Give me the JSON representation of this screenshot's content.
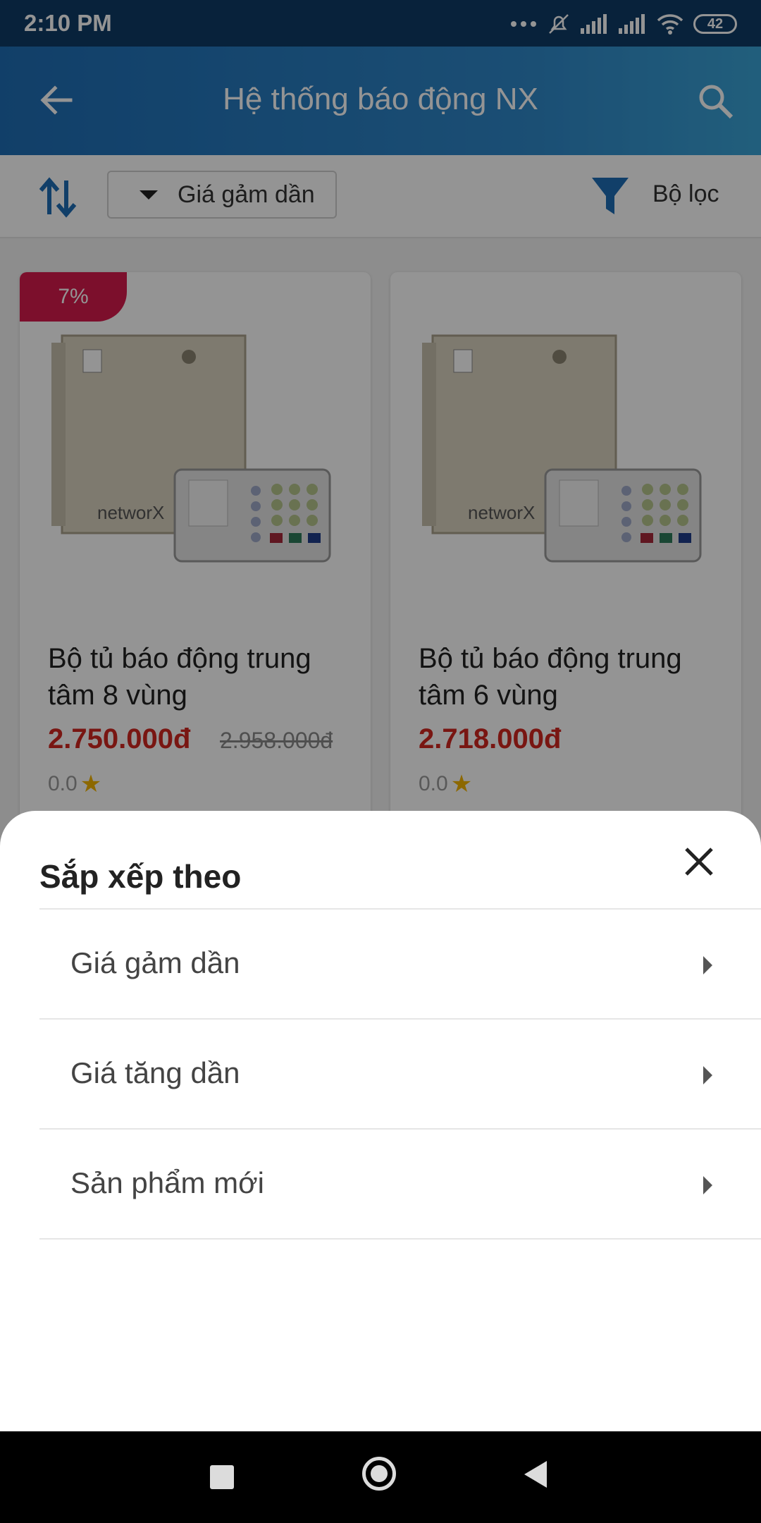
{
  "status_bar": {
    "time": "2:10 PM",
    "battery": "42",
    "icons": [
      "more-dots-icon",
      "mute-icon",
      "signal-icon",
      "signal-icon",
      "wifi-icon",
      "battery-icon"
    ]
  },
  "app_bar": {
    "title": "Hệ thống báo động NX",
    "icons": [
      "back-arrow-icon",
      "search-icon"
    ]
  },
  "toolbar": {
    "sort_selected": "Giá gảm dần",
    "filter_label": "Bộ lọc",
    "icons": [
      "sort-arrows-icon",
      "caret-down-icon",
      "filter-icon"
    ]
  },
  "products": [
    {
      "discount": "7%",
      "name": "Bộ tủ báo động trung tâm 8 vùng",
      "price": "2.750.000đ",
      "old_price": "2.958.000đ",
      "rating": "0.0"
    },
    {
      "discount": "",
      "name": "Bộ tủ báo động trung tâm 6 vùng",
      "price": "2.718.000đ",
      "old_price": "",
      "rating": "0.0"
    }
  ],
  "sort_sheet": {
    "title": "Sắp xếp theo",
    "options": [
      {
        "label": "Giá gảm dần"
      },
      {
        "label": "Giá tăng dần"
      },
      {
        "label": "Sản phẩm mới"
      }
    ],
    "icons": [
      "close-icon",
      "chevron-right-icon"
    ]
  },
  "colors": {
    "app_bar": "#1e6db5",
    "price": "#d0261f",
    "discount_badge": "#d61a4c",
    "star": "#f2b400"
  }
}
